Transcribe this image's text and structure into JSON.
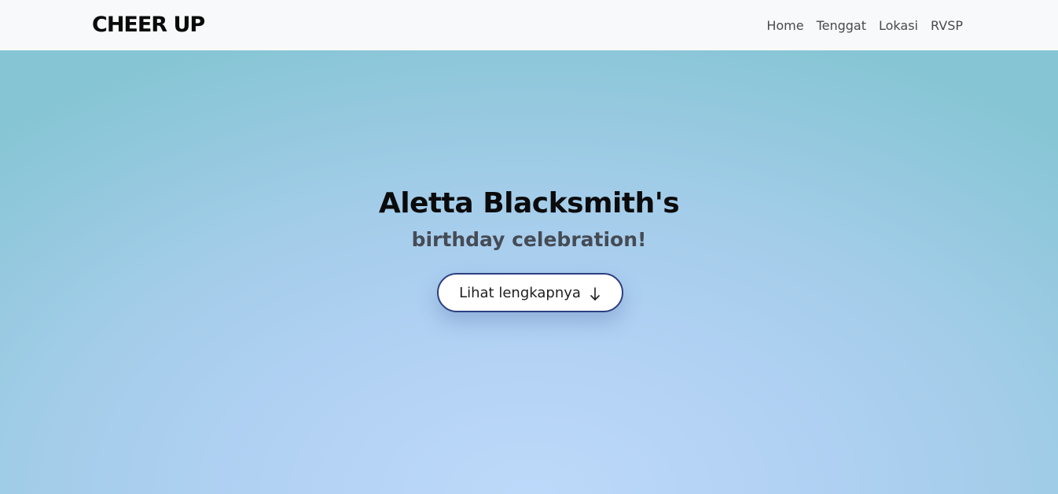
{
  "navbar": {
    "brand": "CHEER UP",
    "links": [
      {
        "label": "Home"
      },
      {
        "label": "Tenggat"
      },
      {
        "label": "Lokasi"
      },
      {
        "label": "RVSP"
      }
    ]
  },
  "hero": {
    "title": "Aletta Blacksmith's",
    "subtitle": "birthday celebration!",
    "button_label": "Lihat lengkapnya",
    "button_icon": "arrow-down-icon"
  },
  "colors": {
    "navbar_bg": "#f8f9fa",
    "hero_center": "#bdd9fa",
    "hero_edge": "#86c5d4",
    "button_border": "#2c3f82",
    "title": "#0b0b0b",
    "subtitle": "#454b55"
  }
}
